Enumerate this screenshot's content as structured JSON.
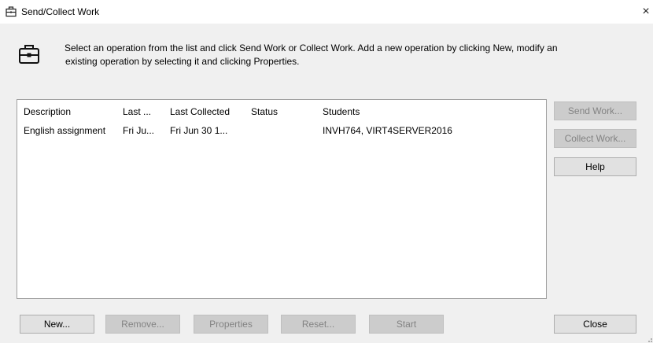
{
  "window": {
    "title": "Send/Collect Work",
    "close_glyph": "×"
  },
  "icons": {
    "title": "briefcase-icon",
    "header": "briefcase-icon"
  },
  "instructions": {
    "line1": "Select an operation from the list and click Send Work or Collect Work. Add a new operation by clicking New, modify an",
    "line2": "existing operation by selecting it and clicking Properties."
  },
  "table": {
    "columns": [
      "Description",
      "Last ...",
      "Last Collected",
      "Status",
      "Students"
    ],
    "rows": [
      {
        "description": "English assignment",
        "last_sent": "Fri Ju...",
        "last_collected": "Fri Jun 30 1...",
        "status": "",
        "students": "INVH764, VIRT4SERVER2016"
      }
    ]
  },
  "side_buttons": {
    "send_work": "Send Work...",
    "collect_work": "Collect Work...",
    "help": "Help"
  },
  "bottom_buttons": {
    "new": "New...",
    "remove": "Remove...",
    "properties": "Properties",
    "reset": "Reset...",
    "start": "Start",
    "close": "Close"
  },
  "colors": {
    "window_bg": "#f0f0f0",
    "titlebar_bg": "#ffffff",
    "list_bg": "#ffffff",
    "disabled_text": "#838383"
  }
}
